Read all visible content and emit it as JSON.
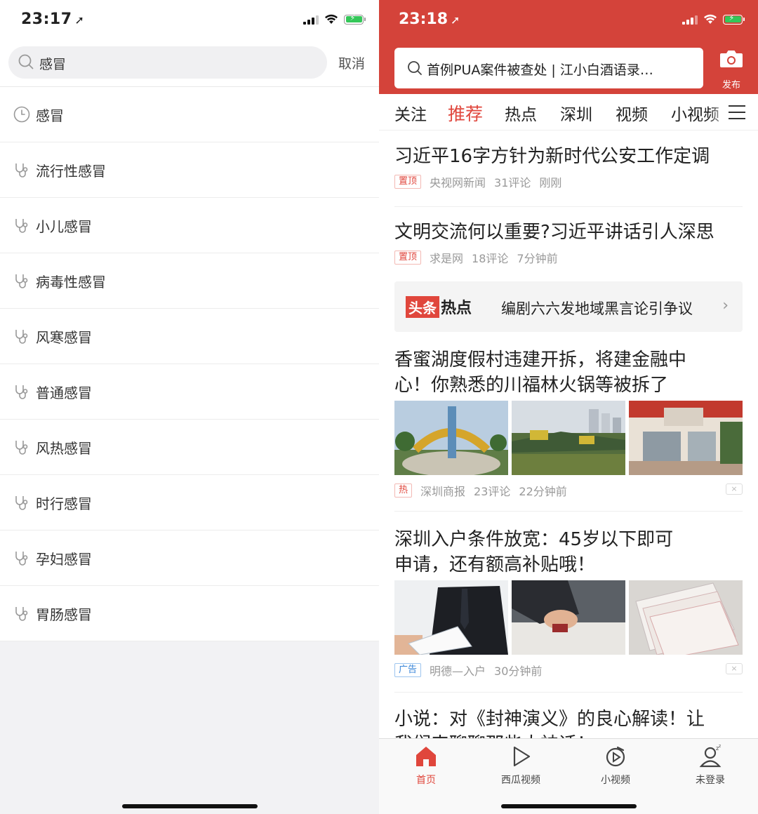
{
  "left_phone": {
    "status_bar": {
      "time": "23:17",
      "location_arrow": "location-arrow-icon"
    },
    "search": {
      "query": "感冒",
      "cancel_label": "取消"
    },
    "suggestions": [
      {
        "label": "感冒",
        "icon": "clock-icon"
      },
      {
        "label": "流行性感冒",
        "icon": "stethoscope-icon"
      },
      {
        "label": "小儿感冒",
        "icon": "stethoscope-icon"
      },
      {
        "label": "病毒性感冒",
        "icon": "stethoscope-icon"
      },
      {
        "label": "风寒感冒",
        "icon": "stethoscope-icon"
      },
      {
        "label": "普通感冒",
        "icon": "stethoscope-icon"
      },
      {
        "label": "风热感冒",
        "icon": "stethoscope-icon"
      },
      {
        "label": "时行感冒",
        "icon": "stethoscope-icon"
      },
      {
        "label": "孕妇感冒",
        "icon": "stethoscope-icon"
      },
      {
        "label": "胃肠感冒",
        "icon": "stethoscope-icon"
      }
    ]
  },
  "right_phone": {
    "status_bar": {
      "time": "23:18"
    },
    "search_placeholder": "首例PUA案件被查处 | 江小白酒语录…",
    "publish_label": "发布",
    "tabs": [
      {
        "label": "关注",
        "active": false
      },
      {
        "label": "推荐",
        "active": true
      },
      {
        "label": "热点",
        "active": false
      },
      {
        "label": "深圳",
        "active": false
      },
      {
        "label": "视频",
        "active": false
      },
      {
        "label": "小视频",
        "active": false
      }
    ],
    "articles": [
      {
        "title": "习近平16字方针为新时代公安工作定调",
        "tag": "置顶",
        "source": "央视网新闻",
        "comments": "31评论",
        "time": "刚刚"
      },
      {
        "title": "文明交流何以重要?习近平讲话引人深思",
        "tag": "置顶",
        "source": "求是网",
        "comments": "18评论",
        "time": "7分钟前"
      }
    ],
    "hot_banner": {
      "logo_a": "头条",
      "logo_b": "热点",
      "text": "编剧六六发地域黑言论引争议",
      "chevron": "›"
    },
    "image_articles": [
      {
        "title_line1": "香蜜湖度假村违建开拆，将建金融中",
        "title_line2": "心！你熟悉的川福林火锅等被拆了",
        "tag": "热",
        "source": "深圳商报",
        "comments": "23评论",
        "time": "22分钟前"
      },
      {
        "title_line1": "深圳入户条件放宽：45岁以下即可",
        "title_line2": "申请，还有额高补贴哦！",
        "tag": "广告",
        "source": "明德—入户",
        "comments": "",
        "time": "30分钟前"
      }
    ],
    "partial_article": {
      "title_line1": "小说：对《封神演义》的良心解读！让",
      "title_line2": "我们来聊聊那些大神话！"
    },
    "dismiss_label": "×",
    "bottom_tabs": [
      {
        "label": "首页",
        "icon": "home-icon",
        "active": true
      },
      {
        "label": "西瓜视频",
        "icon": "play-icon",
        "active": false
      },
      {
        "label": "小视频",
        "icon": "short-video-icon",
        "active": false
      },
      {
        "label": "未登录",
        "icon": "user-icon",
        "active": false
      }
    ],
    "accent_color": "#d4433a"
  }
}
